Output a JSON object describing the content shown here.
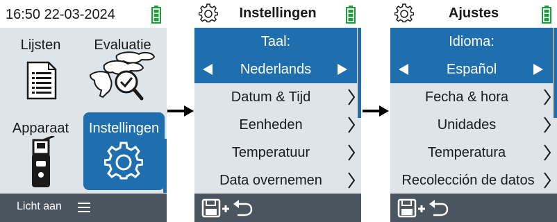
{
  "screen1": {
    "clock": "16:50 22-03-2024",
    "tiles": [
      {
        "label": "Lijsten"
      },
      {
        "label": "Evaluatie"
      },
      {
        "label": "Apparaat"
      },
      {
        "label": "Instellingen"
      }
    ],
    "bottom_text": "Licht aan"
  },
  "screen2": {
    "title": "Instellingen",
    "selector_label": "Taal:",
    "selector_value": "Nederlands",
    "items": [
      "Datum & Tijd",
      "Eenheden",
      "Temperatuur",
      "Data overnemen"
    ]
  },
  "screen3": {
    "title": "Ajustes",
    "selector_label": "Idioma:",
    "selector_value": "Español",
    "items": [
      "Fecha & hora",
      "Unidades",
      "Temperatura",
      "Recolección de datos"
    ]
  },
  "colors": {
    "accent": "#1f6fae",
    "battery": "#1e9e3a",
    "background": "#dfe4e9",
    "bottombar": "#4b5560"
  }
}
